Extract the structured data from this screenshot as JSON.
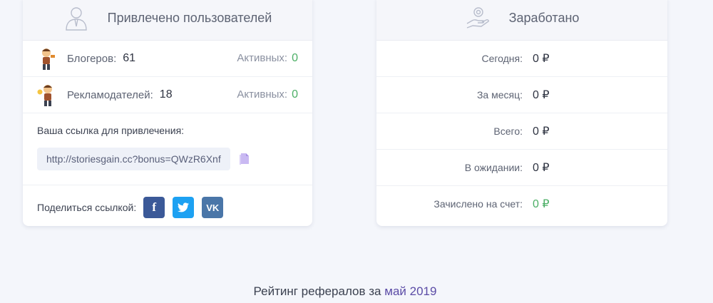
{
  "referrals": {
    "title": "Привлечено пользователей",
    "bloggers_label": "Блогеров:",
    "bloggers_count": "61",
    "bloggers_active_label": "Активных:",
    "bloggers_active_count": "0",
    "advertisers_label": "Рекламодателей:",
    "advertisers_count": "18",
    "advertisers_active_label": "Активных:",
    "advertisers_active_count": "0",
    "link_caption": "Ваша ссылка для привлечения:",
    "link_url": "http://storiesgain.cc?bonus=QWzR6Xnf",
    "share_caption": "Поделиться ссылкой:",
    "share_buttons": {
      "facebook": "f",
      "vk": "VK"
    }
  },
  "earnings": {
    "title": "Заработано",
    "rows": [
      {
        "label": "Сегодня:",
        "value": "0 ₽"
      },
      {
        "label": "За месяц:",
        "value": "0 ₽"
      },
      {
        "label": "Всего:",
        "value": "0 ₽"
      },
      {
        "label": "В ожидании:",
        "value": "0 ₽"
      },
      {
        "label": "Зачислено на счет:",
        "value": "0 ₽"
      }
    ]
  },
  "rating": {
    "prefix": "Рейтинг рефералов за",
    "month": "май 2019"
  },
  "colors": {
    "accent_green": "#4caf66",
    "accent_purple": "#5b4ca6",
    "facebook": "#3b5998",
    "twitter": "#1da1f2",
    "vk": "#4a76a8"
  }
}
